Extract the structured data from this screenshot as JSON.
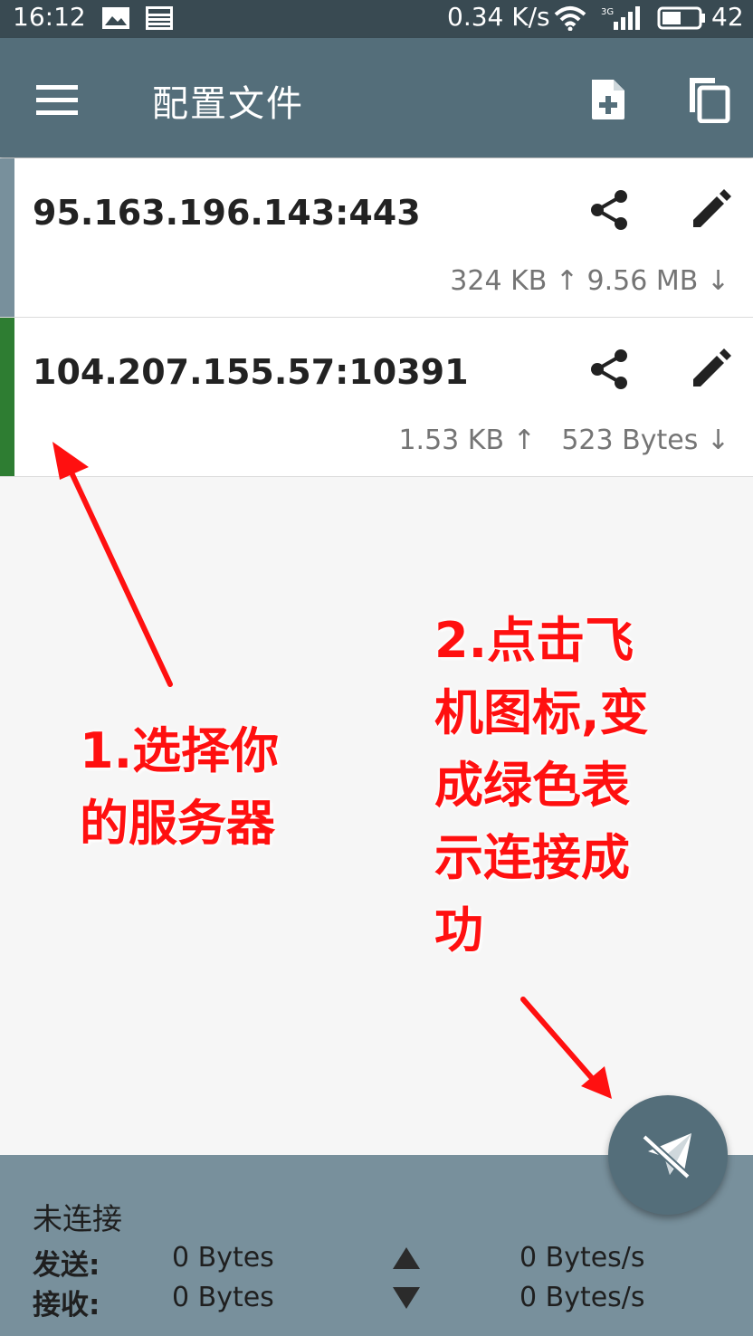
{
  "status_bar": {
    "time": "16:12",
    "speed": "0.34 K/s",
    "battery": "42",
    "icons": [
      "image-icon",
      "news-icon",
      "wifi-icon",
      "signal-3g-icon",
      "battery-icon"
    ]
  },
  "app_bar": {
    "title": "配置文件",
    "menu_icon": "menu-icon",
    "actions": [
      "add-file-icon",
      "copy-icon"
    ]
  },
  "profiles": [
    {
      "address": "95.163.196.143:443",
      "traffic": "324 KB ↑ 9.56 MB ↓",
      "selected": false,
      "stripe_color": "#78909c"
    },
    {
      "address": "104.207.155.57:10391",
      "traffic": "1.53 KB ↑   523 Bytes ↓",
      "selected": true,
      "stripe_color": "#2e7d32"
    }
  ],
  "annotations": {
    "step1_line1": "1.选择你",
    "step1_line2": "的服务器",
    "step2_lines": [
      "2.点击飞",
      "机图标,变",
      "成绿色表",
      "示连接成",
      "功"
    ],
    "color": "#ff1010"
  },
  "status_panel": {
    "state": "未连接",
    "send_label": "发送:",
    "send_value": "0 Bytes",
    "send_rate": "0 Bytes/s",
    "recv_label": "接收:",
    "recv_value": "0 Bytes",
    "recv_rate": "0 Bytes/s"
  },
  "fab": {
    "icon": "airplane-off-icon"
  }
}
